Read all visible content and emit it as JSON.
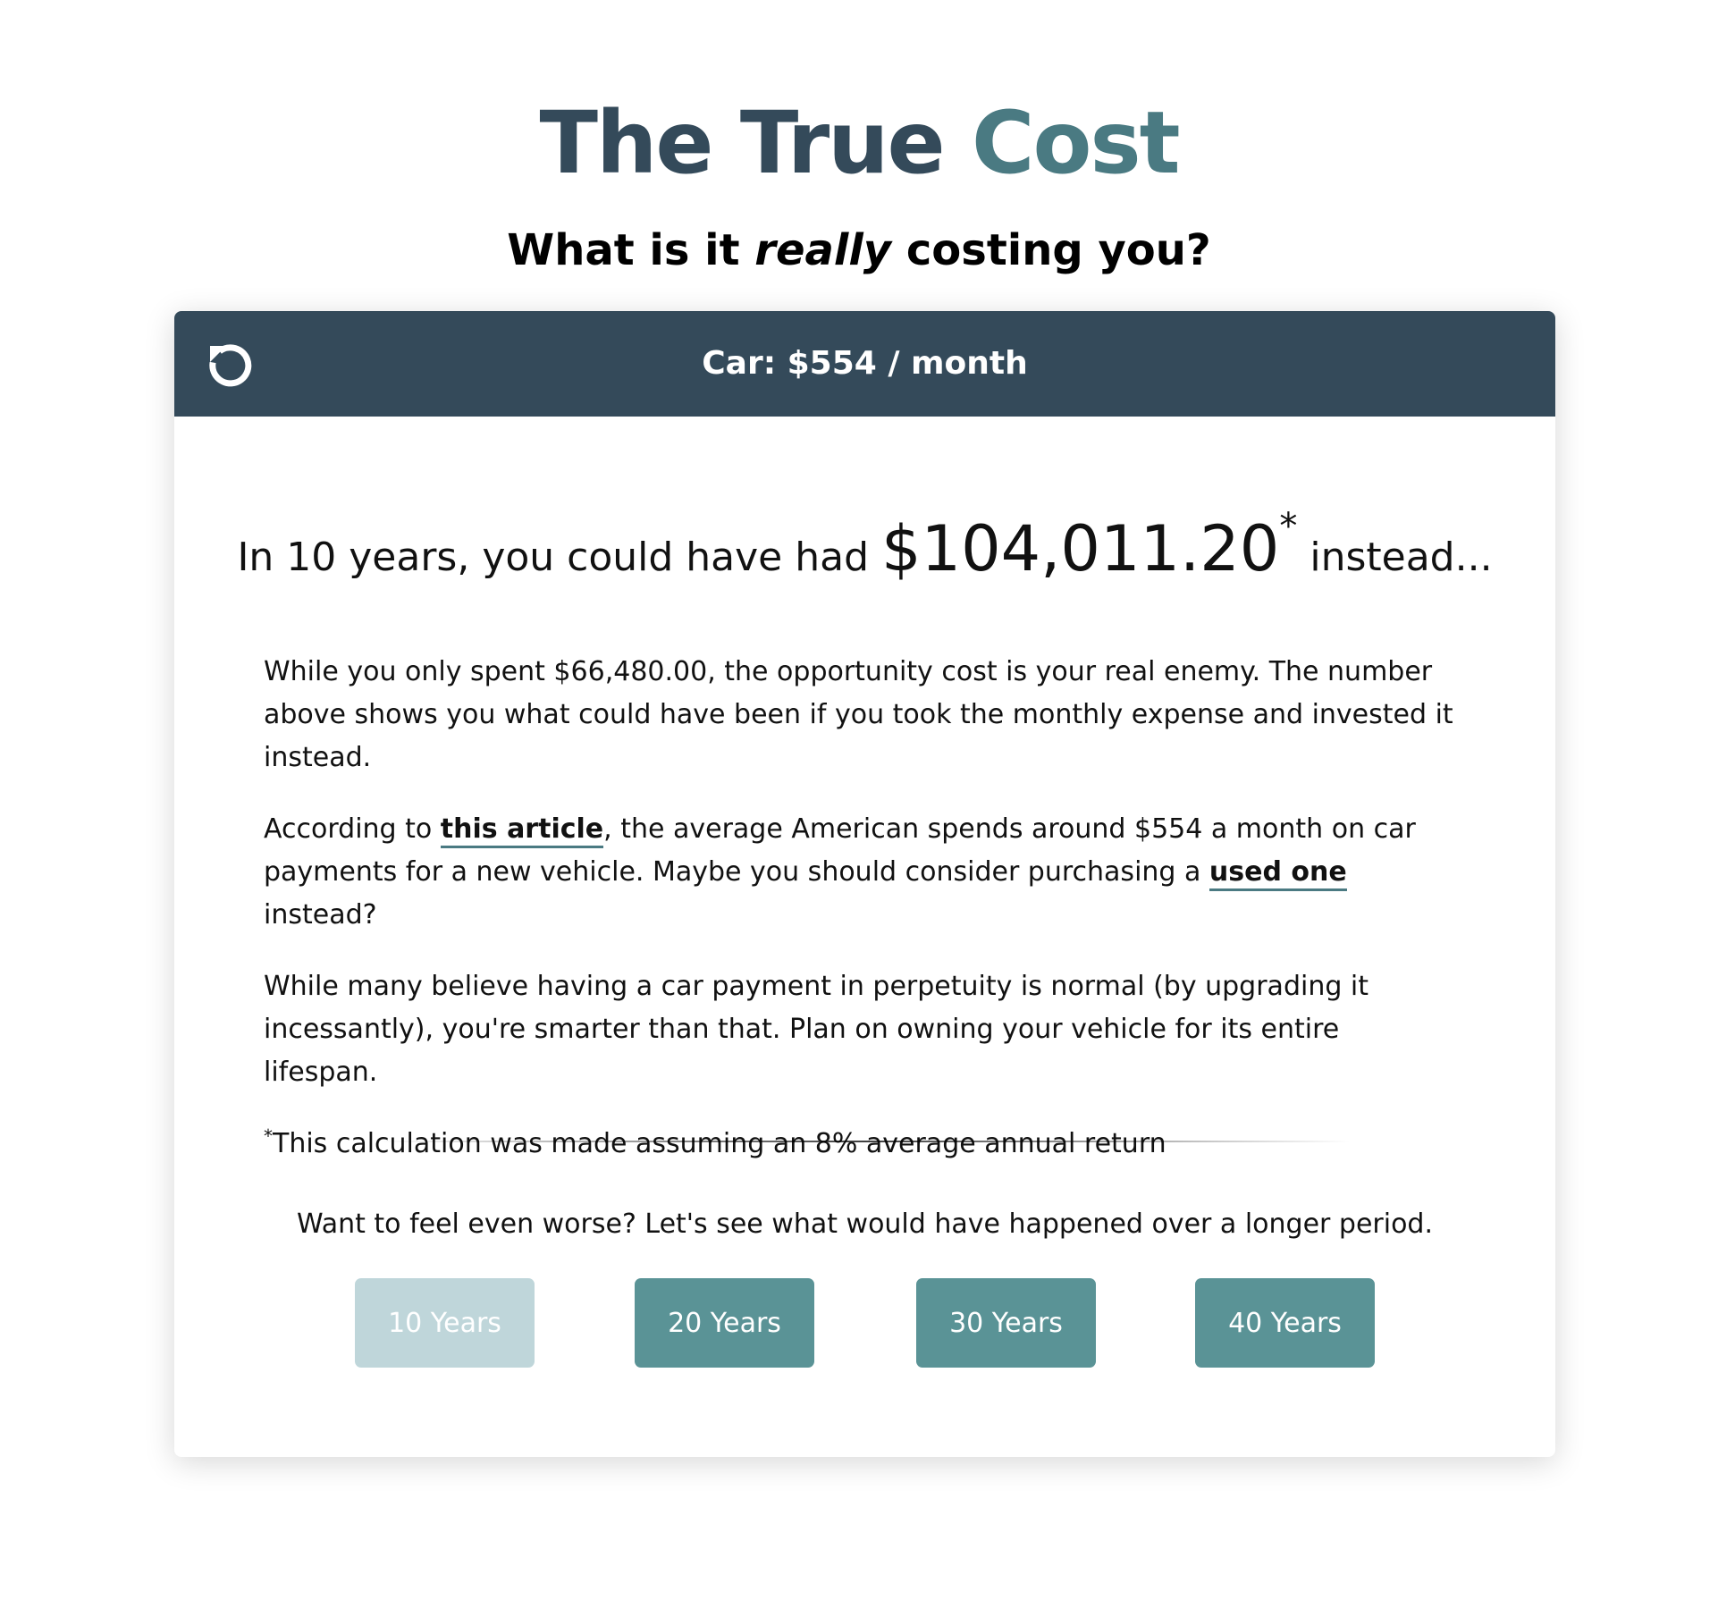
{
  "page": {
    "title_part1": "The True",
    "title_part2": "Cost",
    "subtitle_before": "What is it",
    "subtitle_emphasis": "really",
    "subtitle_after": "costing you?"
  },
  "card": {
    "header_title": "Car: $554 / month",
    "reset_icon": "reset-icon",
    "headline_prefix": "In 10 years, you could have had",
    "headline_amount": "$104,011.20",
    "headline_marker": "*",
    "headline_suffix": "instead...",
    "paragraph1": "While you only spent $66,480.00, the opportunity cost is your real enemy. The number above shows you what could have been if you took the monthly expense and invested it instead.",
    "paragraph2_before": "According to",
    "paragraph2_link1": "this article",
    "paragraph2_middle": ", the average American spends around $554 a month on car payments for a new vehicle. Maybe you should consider purchasing a",
    "paragraph2_link2": "used one",
    "paragraph2_after": "instead?",
    "paragraph3": "While many believe having a car payment in perpetuity is normal (by upgrading it incessantly), you're smarter than that. Plan on owning your vehicle for its entire lifespan.",
    "footnote_marker": "*",
    "footnote_text": "This calculation was made assuming an 8% average annual return",
    "prompt": "Want to feel even worse? Let's see what would have happened over a longer period.",
    "buttons": [
      {
        "label": "10 Years",
        "disabled": true
      },
      {
        "label": "20 Years",
        "disabled": false
      },
      {
        "label": "30 Years",
        "disabled": false
      },
      {
        "label": "40 Years",
        "disabled": false
      }
    ]
  },
  "colors": {
    "header_bg": "#344a5a",
    "title_dark": "#344a5a",
    "title_teal": "#4a7a82",
    "button_active": "#5a9396",
    "button_disabled": "#bfd6da"
  }
}
